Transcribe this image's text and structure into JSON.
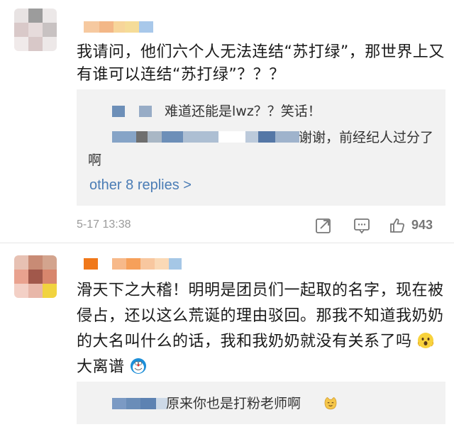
{
  "comments": [
    {
      "text": "我请问，他们六个人无法连结“苏打绿”，那世界上又有谁可以连结“苏打绿”？？？",
      "replies": [
        {
          "text": "难道还能是lwz？？笑话！"
        },
        {
          "text": "谢谢，前经纪人过分了啊"
        }
      ],
      "more_replies": "other 8 replies >",
      "timestamp": "5-17 13:38",
      "likes": "943"
    },
    {
      "text": "滑天下之大稽！明明是团员们一起取的名字，现在被侵占，还以这么荒诞的理由驳回。那我不知道我奶奶的大名叫什么的话，我和我奶奶就没有关系了吗",
      "text_suffix": "大离谱",
      "replies": [
        {
          "text": "原来你也是打粉老师啊"
        }
      ]
    }
  ],
  "icons": {
    "share": "share-icon",
    "comment": "comment-icon",
    "like": "thumbs-up-icon",
    "emoji_shocked": "shocked-face-emoji",
    "emoji_doraemon": "doraemon-emoji",
    "emoji_cat": "cat-face-emoji"
  },
  "colors": {
    "link": "#4a7cb5",
    "reply_bg": "#f2f2f2",
    "meta": "#9a9a9a"
  }
}
